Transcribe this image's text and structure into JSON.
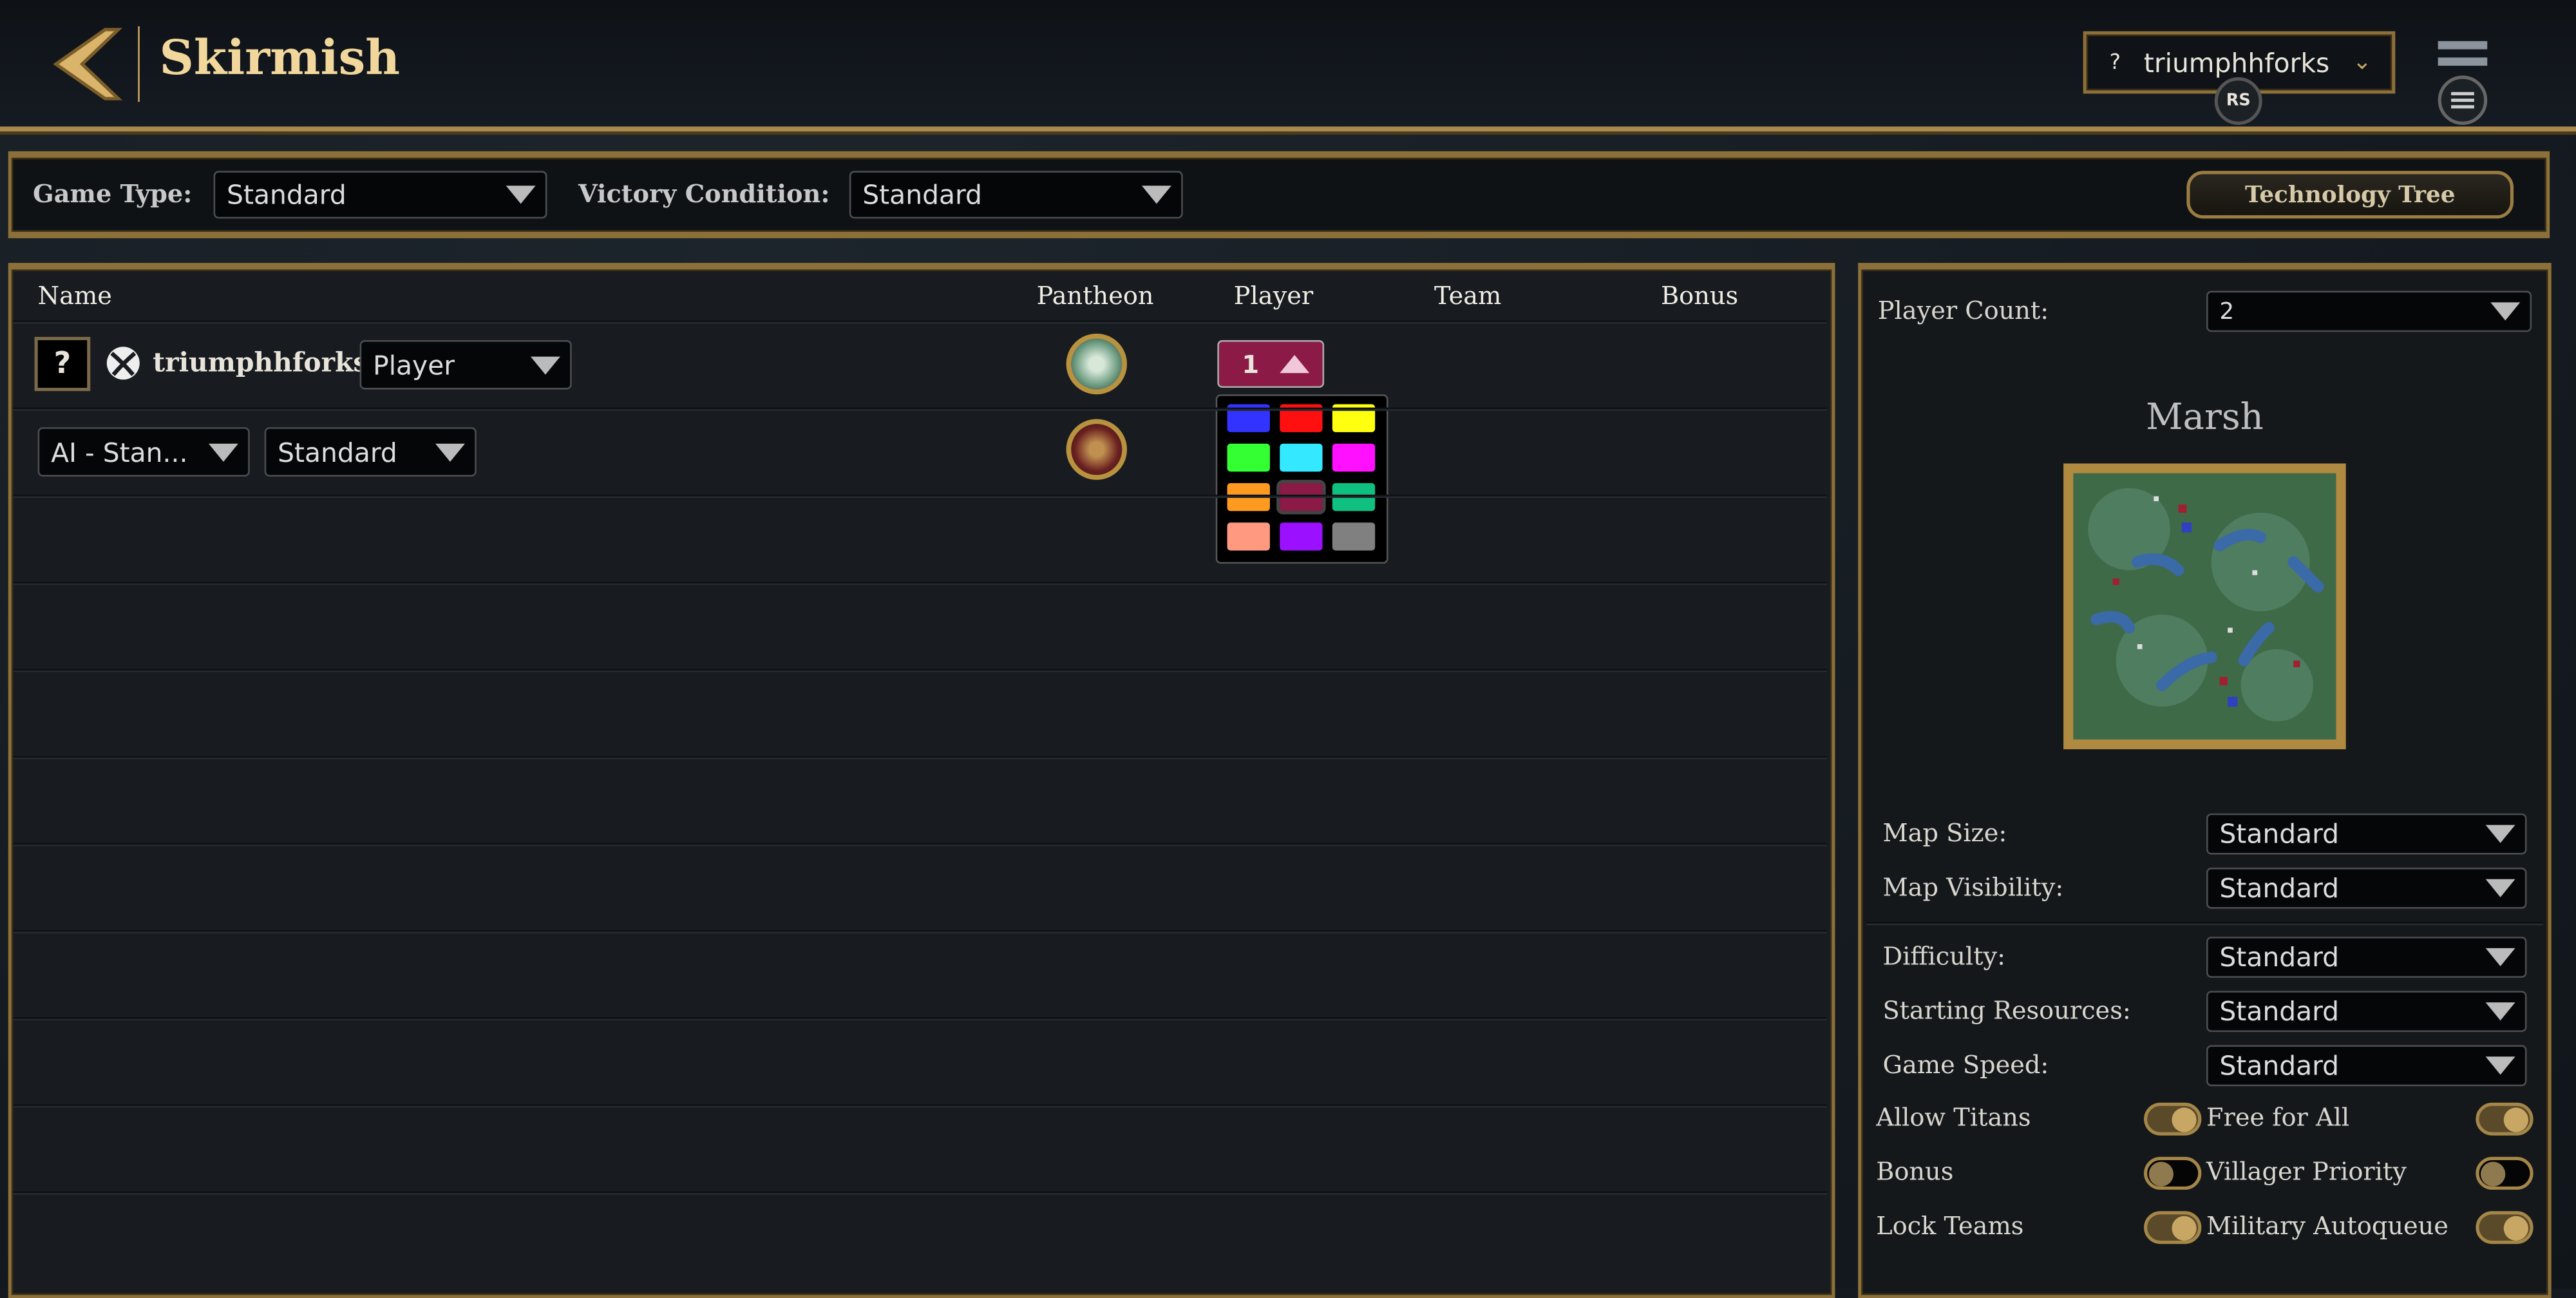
{
  "header": {
    "title": "Skirmish",
    "profile": {
      "prefix": "?",
      "name": "triumphhforks",
      "badge": "RS"
    }
  },
  "settings_bar": {
    "game_type_label": "Game Type:",
    "game_type_value": "Standard",
    "victory_label": "Victory Condition:",
    "victory_value": "Standard",
    "tech_tree_label": "Technology Tree"
  },
  "players_table": {
    "columns": [
      "Name",
      "Pantheon",
      "Player",
      "Team",
      "Bonus"
    ],
    "rows": [
      {
        "avatar": "?",
        "name": "triumphhforks",
        "type": "Player",
        "player_number": "1",
        "player_color": "#8b1a47"
      },
      {
        "type": "AI - Stan...",
        "difficulty": "Standard"
      }
    ],
    "color_picker": {
      "colors": [
        "#3333ff",
        "#ff1010",
        "#ffff10",
        "#33ff33",
        "#33e8ff",
        "#ff10ff",
        "#ff9a20",
        "#8b1a47",
        "#10c080",
        "#ff9a80",
        "#9a10ff",
        "#808080"
      ],
      "selected": "#8b1a47"
    }
  },
  "game_panel": {
    "player_count_label": "Player Count:",
    "player_count": "2",
    "map_name": "Marsh",
    "dropdowns": [
      {
        "label": "Map Size:",
        "value": "Standard"
      },
      {
        "label": "Map Visibility:",
        "value": "Standard"
      },
      {
        "label": "Difficulty:",
        "value": "Standard"
      },
      {
        "label": "Starting Resources:",
        "value": "Standard"
      },
      {
        "label": "Game Speed:",
        "value": "Standard"
      }
    ],
    "toggles": [
      {
        "label": "Allow Titans",
        "on": true
      },
      {
        "label": "Free for All",
        "on": true
      },
      {
        "label": "Bonus",
        "on": false
      },
      {
        "label": "Villager Priority",
        "on": false
      },
      {
        "label": "Lock Teams",
        "on": true
      },
      {
        "label": "Military Autoqueue",
        "on": true
      }
    ]
  }
}
